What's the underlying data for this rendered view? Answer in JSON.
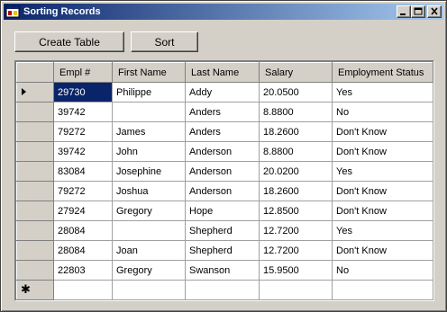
{
  "window": {
    "title": "Sorting Records"
  },
  "toolbar": {
    "create_label": "Create Table",
    "sort_label": "Sort"
  },
  "grid": {
    "columns": [
      "Empl #",
      "First Name",
      "Last Name",
      "Salary",
      "Employment Status"
    ],
    "rows": [
      [
        "29730",
        "Philippe",
        "Addy",
        "20.0500",
        "Yes"
      ],
      [
        "39742",
        "",
        "Anders",
        "8.8800",
        "No"
      ],
      [
        "79272",
        "James",
        "Anders",
        "18.2600",
        "Don't Know"
      ],
      [
        "39742",
        "John",
        "Anderson",
        "8.8800",
        "Don't Know"
      ],
      [
        "83084",
        "Josephine",
        "Anderson",
        "20.0200",
        "Yes"
      ],
      [
        "79272",
        "Joshua",
        "Anderson",
        "18.2600",
        "Don't Know"
      ],
      [
        "27924",
        "Gregory",
        "Hope",
        "12.8500",
        "Don't Know"
      ],
      [
        "28084",
        "",
        "Shepherd",
        "12.7200",
        "Yes"
      ],
      [
        "28084",
        "Joan",
        "Shepherd",
        "12.7200",
        "Don't Know"
      ],
      [
        "22803",
        "Gregory",
        "Swanson",
        "15.9500",
        "No"
      ]
    ],
    "selected_row": 0,
    "selected_col": 0,
    "current_row_icon": "row-pointer-icon",
    "new_row_icon": "new-row-asterisk-icon",
    "new_row_glyph": "✱"
  },
  "colors": {
    "title_start": "#0a246a",
    "title_end": "#a6caf0",
    "selection": "#0a246a",
    "face": "#d4d0c8"
  }
}
